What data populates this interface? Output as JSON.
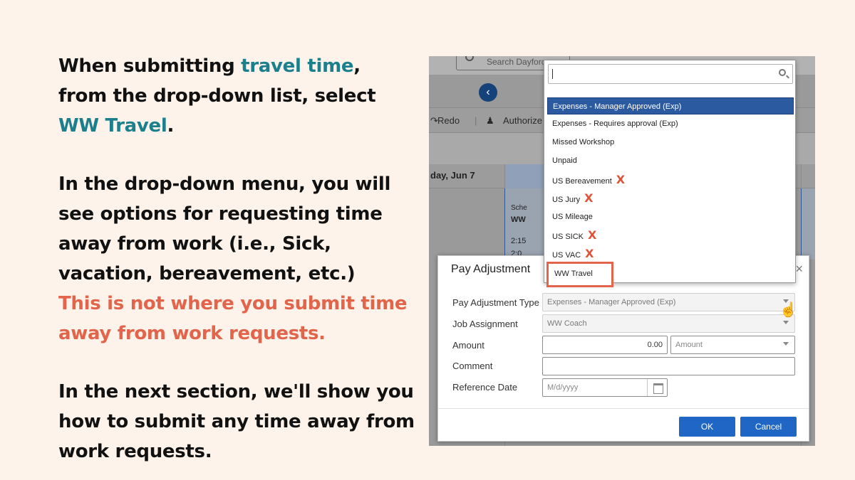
{
  "instructions": {
    "p1_a": "When submitting ",
    "p1_hl": "travel time",
    "p1_b": ", from the drop-down list, select ",
    "p1_hl2": "WW Travel",
    "p1_c": ".",
    "p2": "In the drop-down menu, you will see options for requesting time away from work (i.e., Sick, vacation, bereavement, etc.)",
    "p2_warn": "This is not where you submit time away from work requests.",
    "p3": "In the next section, we'll show you how to submit any time away from work requests."
  },
  "background": {
    "search_placeholder": "Search Dayforce",
    "redo_label": "Redo",
    "authorize_label": "Authorize",
    "day_label": "day, Jun 7",
    "sched_label": "Sche",
    "ww_label": "WW",
    "time1": "2:15",
    "time2": "2:0"
  },
  "dialog": {
    "title": "Pay Adjustment",
    "close": "×",
    "labels": {
      "type": "Pay Adjustment Type",
      "job": "Job Assignment",
      "amount": "Amount",
      "comment": "Comment",
      "ref_date": "Reference Date"
    },
    "values": {
      "type": "Expenses - Manager Approved (Exp)",
      "job": "WW Coach",
      "amount": "0.00",
      "amount_unit": "Amount",
      "comment": "",
      "ref_date_placeholder": "M/d/yyyy"
    },
    "ok": "OK",
    "cancel": "Cancel"
  },
  "dropdown": {
    "search_value": "",
    "items": [
      {
        "label": "Expenses - Manager Approved (Exp)",
        "selected": true,
        "x": false
      },
      {
        "label": "Expenses - Requires approval (Exp)",
        "selected": false,
        "x": false
      },
      {
        "label": "Missed Workshop",
        "selected": false,
        "x": false
      },
      {
        "label": "Unpaid",
        "selected": false,
        "x": false
      },
      {
        "label": "US Bereavement",
        "selected": false,
        "x": true
      },
      {
        "label": "US Jury",
        "selected": false,
        "x": true
      },
      {
        "label": "US Mileage",
        "selected": false,
        "x": false
      },
      {
        "label": "US SICK",
        "selected": false,
        "x": true
      },
      {
        "label": "US VAC",
        "selected": false,
        "x": true
      }
    ],
    "highlighted_item": "WW Travel",
    "x_mark": "X"
  },
  "colors": {
    "accent_teal": "#1b7f8c",
    "warning": "#e2644a",
    "button_blue": "#1f66c5",
    "selected_blue": "#2c5aa0",
    "background": "#fdf3eb"
  },
  "icons": [
    "search-icon",
    "back-arrow-icon",
    "redo-icon",
    "authorize-icon",
    "calendar-icon",
    "hand-cursor-icon",
    "close-icon",
    "chevron-down-icon"
  ]
}
